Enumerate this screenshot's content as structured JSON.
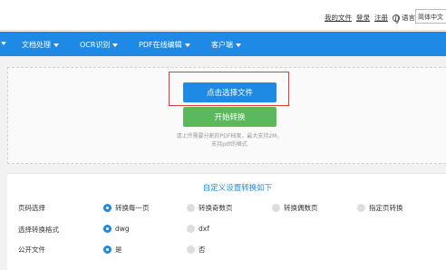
{
  "header": {
    "links": [
      "我的文件",
      "登录",
      "注册"
    ],
    "lang_label": "语言",
    "lang_select": "简体中文"
  },
  "nav": {
    "items": [
      "文档处理",
      "OCR识别",
      "PDF在线编辑",
      "客户端"
    ]
  },
  "upload": {
    "select_label": "点击选择文件",
    "start_label": "开始转换",
    "hint_line1": "请上传需要分割的PDF档案，最大支持2M，",
    "hint_line2": "支持pdf的格式"
  },
  "settings": {
    "title": "自定义设置转换如下",
    "rows": [
      {
        "label": "页码选择",
        "options": [
          "转换每一页",
          "转换奇数页",
          "转换偶数页",
          "指定页转换"
        ],
        "selected": 0
      },
      {
        "label": "选择转换格式",
        "options": [
          "dwg",
          "dxf"
        ],
        "selected": 0
      },
      {
        "label": "公开文件",
        "options": [
          "是",
          "否"
        ],
        "selected": 0
      }
    ]
  },
  "colors": {
    "primary": "#1e8ae6",
    "success": "#5cb85c",
    "highlight": "#e03c3c"
  }
}
